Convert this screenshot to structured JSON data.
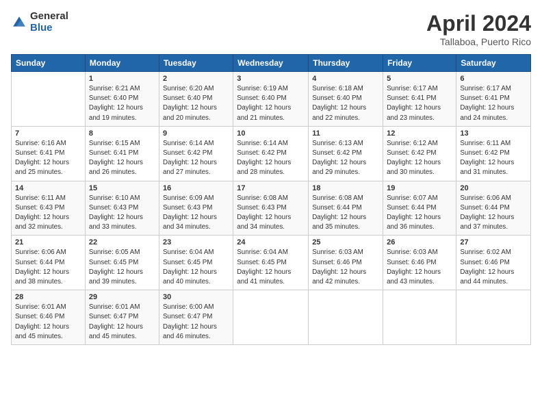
{
  "header": {
    "logo_general": "General",
    "logo_blue": "Blue",
    "title": "April 2024",
    "subtitle": "Tallaboa, Puerto Rico"
  },
  "days_of_week": [
    "Sunday",
    "Monday",
    "Tuesday",
    "Wednesday",
    "Thursday",
    "Friday",
    "Saturday"
  ],
  "weeks": [
    [
      {
        "day": "",
        "info": ""
      },
      {
        "day": "1",
        "info": "Sunrise: 6:21 AM\nSunset: 6:40 PM\nDaylight: 12 hours\nand 19 minutes."
      },
      {
        "day": "2",
        "info": "Sunrise: 6:20 AM\nSunset: 6:40 PM\nDaylight: 12 hours\nand 20 minutes."
      },
      {
        "day": "3",
        "info": "Sunrise: 6:19 AM\nSunset: 6:40 PM\nDaylight: 12 hours\nand 21 minutes."
      },
      {
        "day": "4",
        "info": "Sunrise: 6:18 AM\nSunset: 6:40 PM\nDaylight: 12 hours\nand 22 minutes."
      },
      {
        "day": "5",
        "info": "Sunrise: 6:17 AM\nSunset: 6:41 PM\nDaylight: 12 hours\nand 23 minutes."
      },
      {
        "day": "6",
        "info": "Sunrise: 6:17 AM\nSunset: 6:41 PM\nDaylight: 12 hours\nand 24 minutes."
      }
    ],
    [
      {
        "day": "7",
        "info": "Sunrise: 6:16 AM\nSunset: 6:41 PM\nDaylight: 12 hours\nand 25 minutes."
      },
      {
        "day": "8",
        "info": "Sunrise: 6:15 AM\nSunset: 6:41 PM\nDaylight: 12 hours\nand 26 minutes."
      },
      {
        "day": "9",
        "info": "Sunrise: 6:14 AM\nSunset: 6:42 PM\nDaylight: 12 hours\nand 27 minutes."
      },
      {
        "day": "10",
        "info": "Sunrise: 6:14 AM\nSunset: 6:42 PM\nDaylight: 12 hours\nand 28 minutes."
      },
      {
        "day": "11",
        "info": "Sunrise: 6:13 AM\nSunset: 6:42 PM\nDaylight: 12 hours\nand 29 minutes."
      },
      {
        "day": "12",
        "info": "Sunrise: 6:12 AM\nSunset: 6:42 PM\nDaylight: 12 hours\nand 30 minutes."
      },
      {
        "day": "13",
        "info": "Sunrise: 6:11 AM\nSunset: 6:42 PM\nDaylight: 12 hours\nand 31 minutes."
      }
    ],
    [
      {
        "day": "14",
        "info": "Sunrise: 6:11 AM\nSunset: 6:43 PM\nDaylight: 12 hours\nand 32 minutes."
      },
      {
        "day": "15",
        "info": "Sunrise: 6:10 AM\nSunset: 6:43 PM\nDaylight: 12 hours\nand 33 minutes."
      },
      {
        "day": "16",
        "info": "Sunrise: 6:09 AM\nSunset: 6:43 PM\nDaylight: 12 hours\nand 34 minutes."
      },
      {
        "day": "17",
        "info": "Sunrise: 6:08 AM\nSunset: 6:43 PM\nDaylight: 12 hours\nand 34 minutes."
      },
      {
        "day": "18",
        "info": "Sunrise: 6:08 AM\nSunset: 6:44 PM\nDaylight: 12 hours\nand 35 minutes."
      },
      {
        "day": "19",
        "info": "Sunrise: 6:07 AM\nSunset: 6:44 PM\nDaylight: 12 hours\nand 36 minutes."
      },
      {
        "day": "20",
        "info": "Sunrise: 6:06 AM\nSunset: 6:44 PM\nDaylight: 12 hours\nand 37 minutes."
      }
    ],
    [
      {
        "day": "21",
        "info": "Sunrise: 6:06 AM\nSunset: 6:44 PM\nDaylight: 12 hours\nand 38 minutes."
      },
      {
        "day": "22",
        "info": "Sunrise: 6:05 AM\nSunset: 6:45 PM\nDaylight: 12 hours\nand 39 minutes."
      },
      {
        "day": "23",
        "info": "Sunrise: 6:04 AM\nSunset: 6:45 PM\nDaylight: 12 hours\nand 40 minutes."
      },
      {
        "day": "24",
        "info": "Sunrise: 6:04 AM\nSunset: 6:45 PM\nDaylight: 12 hours\nand 41 minutes."
      },
      {
        "day": "25",
        "info": "Sunrise: 6:03 AM\nSunset: 6:46 PM\nDaylight: 12 hours\nand 42 minutes."
      },
      {
        "day": "26",
        "info": "Sunrise: 6:03 AM\nSunset: 6:46 PM\nDaylight: 12 hours\nand 43 minutes."
      },
      {
        "day": "27",
        "info": "Sunrise: 6:02 AM\nSunset: 6:46 PM\nDaylight: 12 hours\nand 44 minutes."
      }
    ],
    [
      {
        "day": "28",
        "info": "Sunrise: 6:01 AM\nSunset: 6:46 PM\nDaylight: 12 hours\nand 45 minutes."
      },
      {
        "day": "29",
        "info": "Sunrise: 6:01 AM\nSunset: 6:47 PM\nDaylight: 12 hours\nand 45 minutes."
      },
      {
        "day": "30",
        "info": "Sunrise: 6:00 AM\nSunset: 6:47 PM\nDaylight: 12 hours\nand 46 minutes."
      },
      {
        "day": "",
        "info": ""
      },
      {
        "day": "",
        "info": ""
      },
      {
        "day": "",
        "info": ""
      },
      {
        "day": "",
        "info": ""
      }
    ]
  ]
}
